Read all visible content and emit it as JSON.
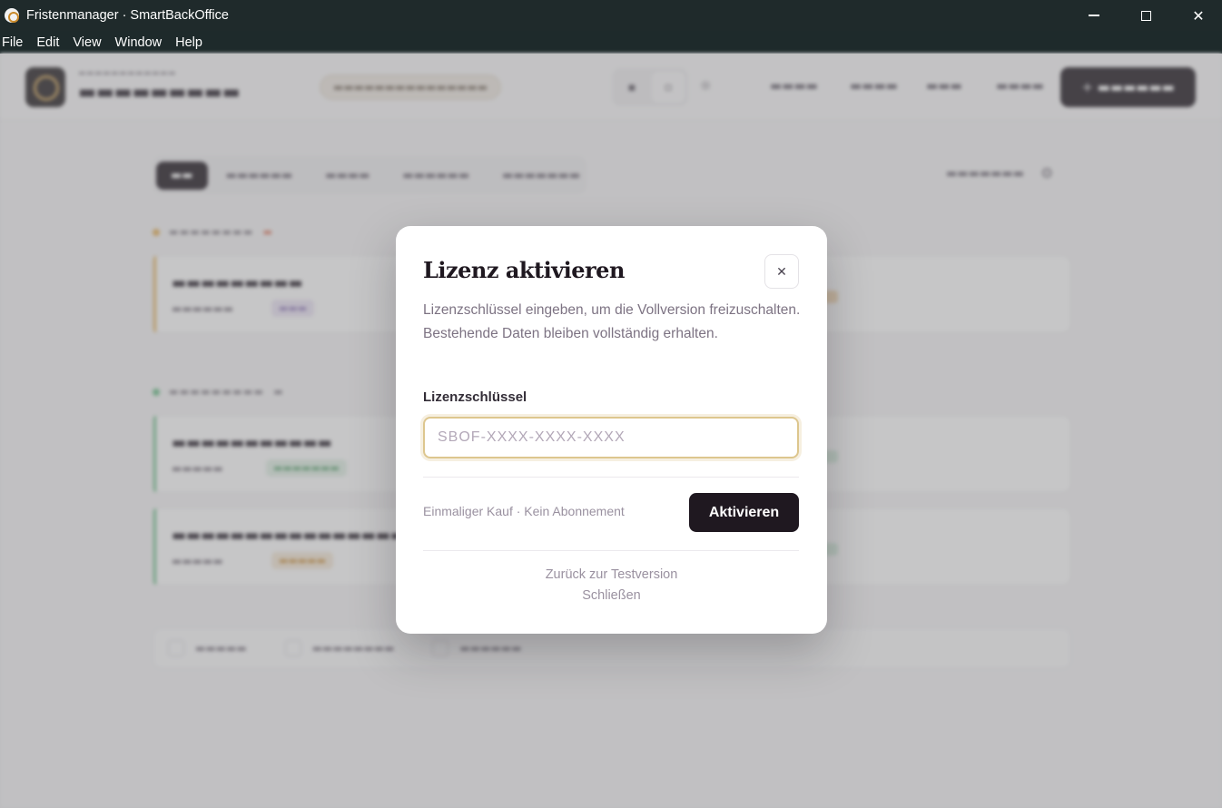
{
  "window": {
    "title": "Fristenmanager · SmartBackOffice",
    "controls": {
      "minimize": "minimize-icon",
      "maximize": "maximize-icon",
      "close": "✕"
    }
  },
  "menu": [
    "File",
    "Edit",
    "View",
    "Window",
    "Help"
  ],
  "modal": {
    "title": "Lizenz aktivieren",
    "close_icon": "✕",
    "description": "Lizenzschlüssel eingeben, um die Vollversion freizuschalten. Bestehende Daten bleiben vollständig erhalten.",
    "field_label": "Lizenzschlüssel",
    "input_placeholder": "SBOF-XXXX-XXXX-XXXX",
    "input_value": "",
    "purchase_note": "Einmaliger Kauf · Kein Abonnement",
    "activate_label": "Aktivieren",
    "back_to_trial": "Zurück zur Testversion",
    "close_label": "Schließen"
  },
  "colors": {
    "titlebar": "#1f2a2b",
    "primary_button": "#1f1820",
    "input_focus": "#ddc68e",
    "overdue_accent": "#e8b35a",
    "planned_accent": "#6cc08a"
  }
}
